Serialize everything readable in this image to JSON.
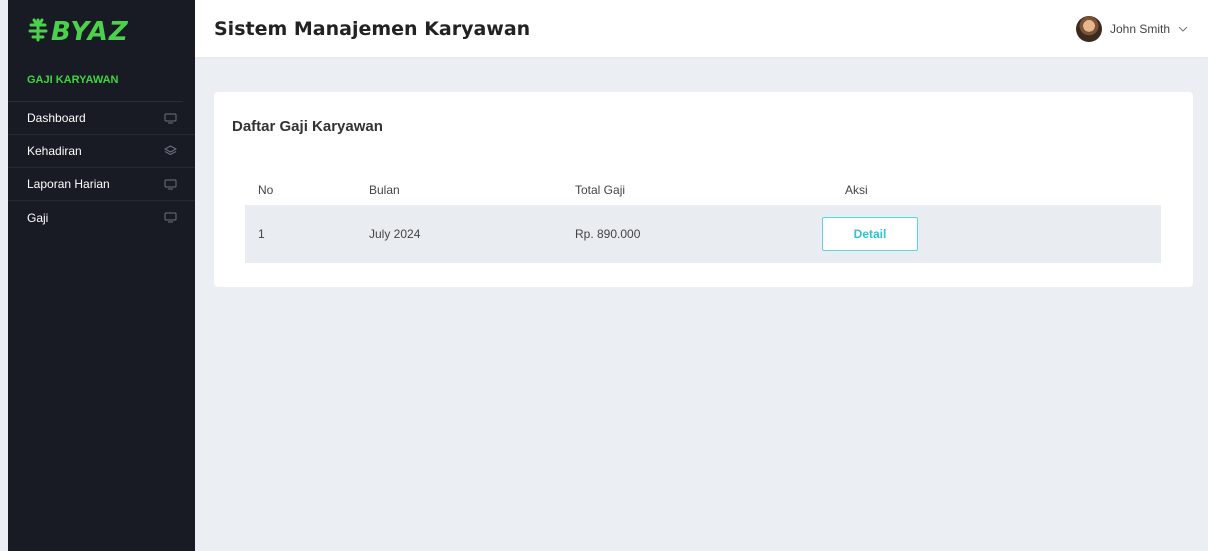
{
  "brand": {
    "logo_text": "BYAZ",
    "accent": "#3ed43e"
  },
  "sidebar": {
    "section_title": "GAJI KARYAWAN",
    "items": [
      {
        "label": "Dashboard",
        "icon": "monitor-icon"
      },
      {
        "label": "Kehadiran",
        "icon": "layers-icon"
      },
      {
        "label": "Laporan Harian",
        "icon": "monitor-icon"
      },
      {
        "label": "Gaji",
        "icon": "monitor-icon"
      }
    ]
  },
  "header": {
    "title": "Sistem Manajemen Karyawan",
    "user_name": "John Smith"
  },
  "card": {
    "title": "Daftar Gaji Karyawan",
    "columns": [
      "No",
      "Bulan",
      "Total Gaji",
      "Aksi"
    ],
    "rows": [
      {
        "no": "1",
        "bulan": "July 2024",
        "total": "Rp. 890.000",
        "action": "Detail"
      }
    ]
  },
  "colors": {
    "sidebar_bg": "#181a24",
    "button_accent": "#2fc4d4"
  }
}
